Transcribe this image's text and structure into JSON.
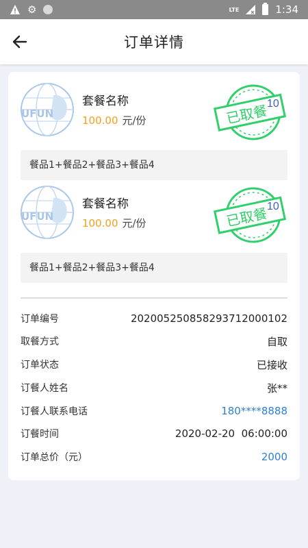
{
  "status_bar": {
    "time": "1:34",
    "network": "LTE",
    "icons": [
      "warning-icon",
      "gear-icon",
      "circle-icon",
      "signal-icon",
      "battery-icon"
    ]
  },
  "header": {
    "title": "订单详情",
    "back_icon": "arrow-left-icon"
  },
  "items": [
    {
      "logo_text": "UFUN",
      "name": "套餐名称",
      "price": "100.00",
      "unit": "元/份",
      "stamp_text": "已取餐",
      "stamp_number": "10",
      "foods": "餐品1+餐品2+餐品3+餐品4"
    },
    {
      "logo_text": "UFUN",
      "name": "套餐名称",
      "price": "100.00",
      "unit": "元/份",
      "stamp_text": "已取餐",
      "stamp_number": "10",
      "foods": "餐品1+餐品2+餐品3+餐品4"
    }
  ],
  "details": [
    {
      "label": "订单编号",
      "value": "202005250858293712000102"
    },
    {
      "label": "取餐方式",
      "value": "自取"
    },
    {
      "label": "订单状态",
      "value": "已接收"
    },
    {
      "label": "订餐人姓名",
      "value": "张**"
    },
    {
      "label": "订餐人联系电话",
      "value": "180****8888"
    },
    {
      "label": "订餐时间",
      "value": "2020-02-20  06:00:00"
    },
    {
      "label": "订单总价（元）",
      "value": "2000"
    }
  ],
  "colors": {
    "status_bar": "#8a8a8a",
    "background": "#eef1f7",
    "price": "#f0a020",
    "link": "#2d7fd6",
    "stamp": "#2fcf6a",
    "logo": "#a9c6ea"
  }
}
